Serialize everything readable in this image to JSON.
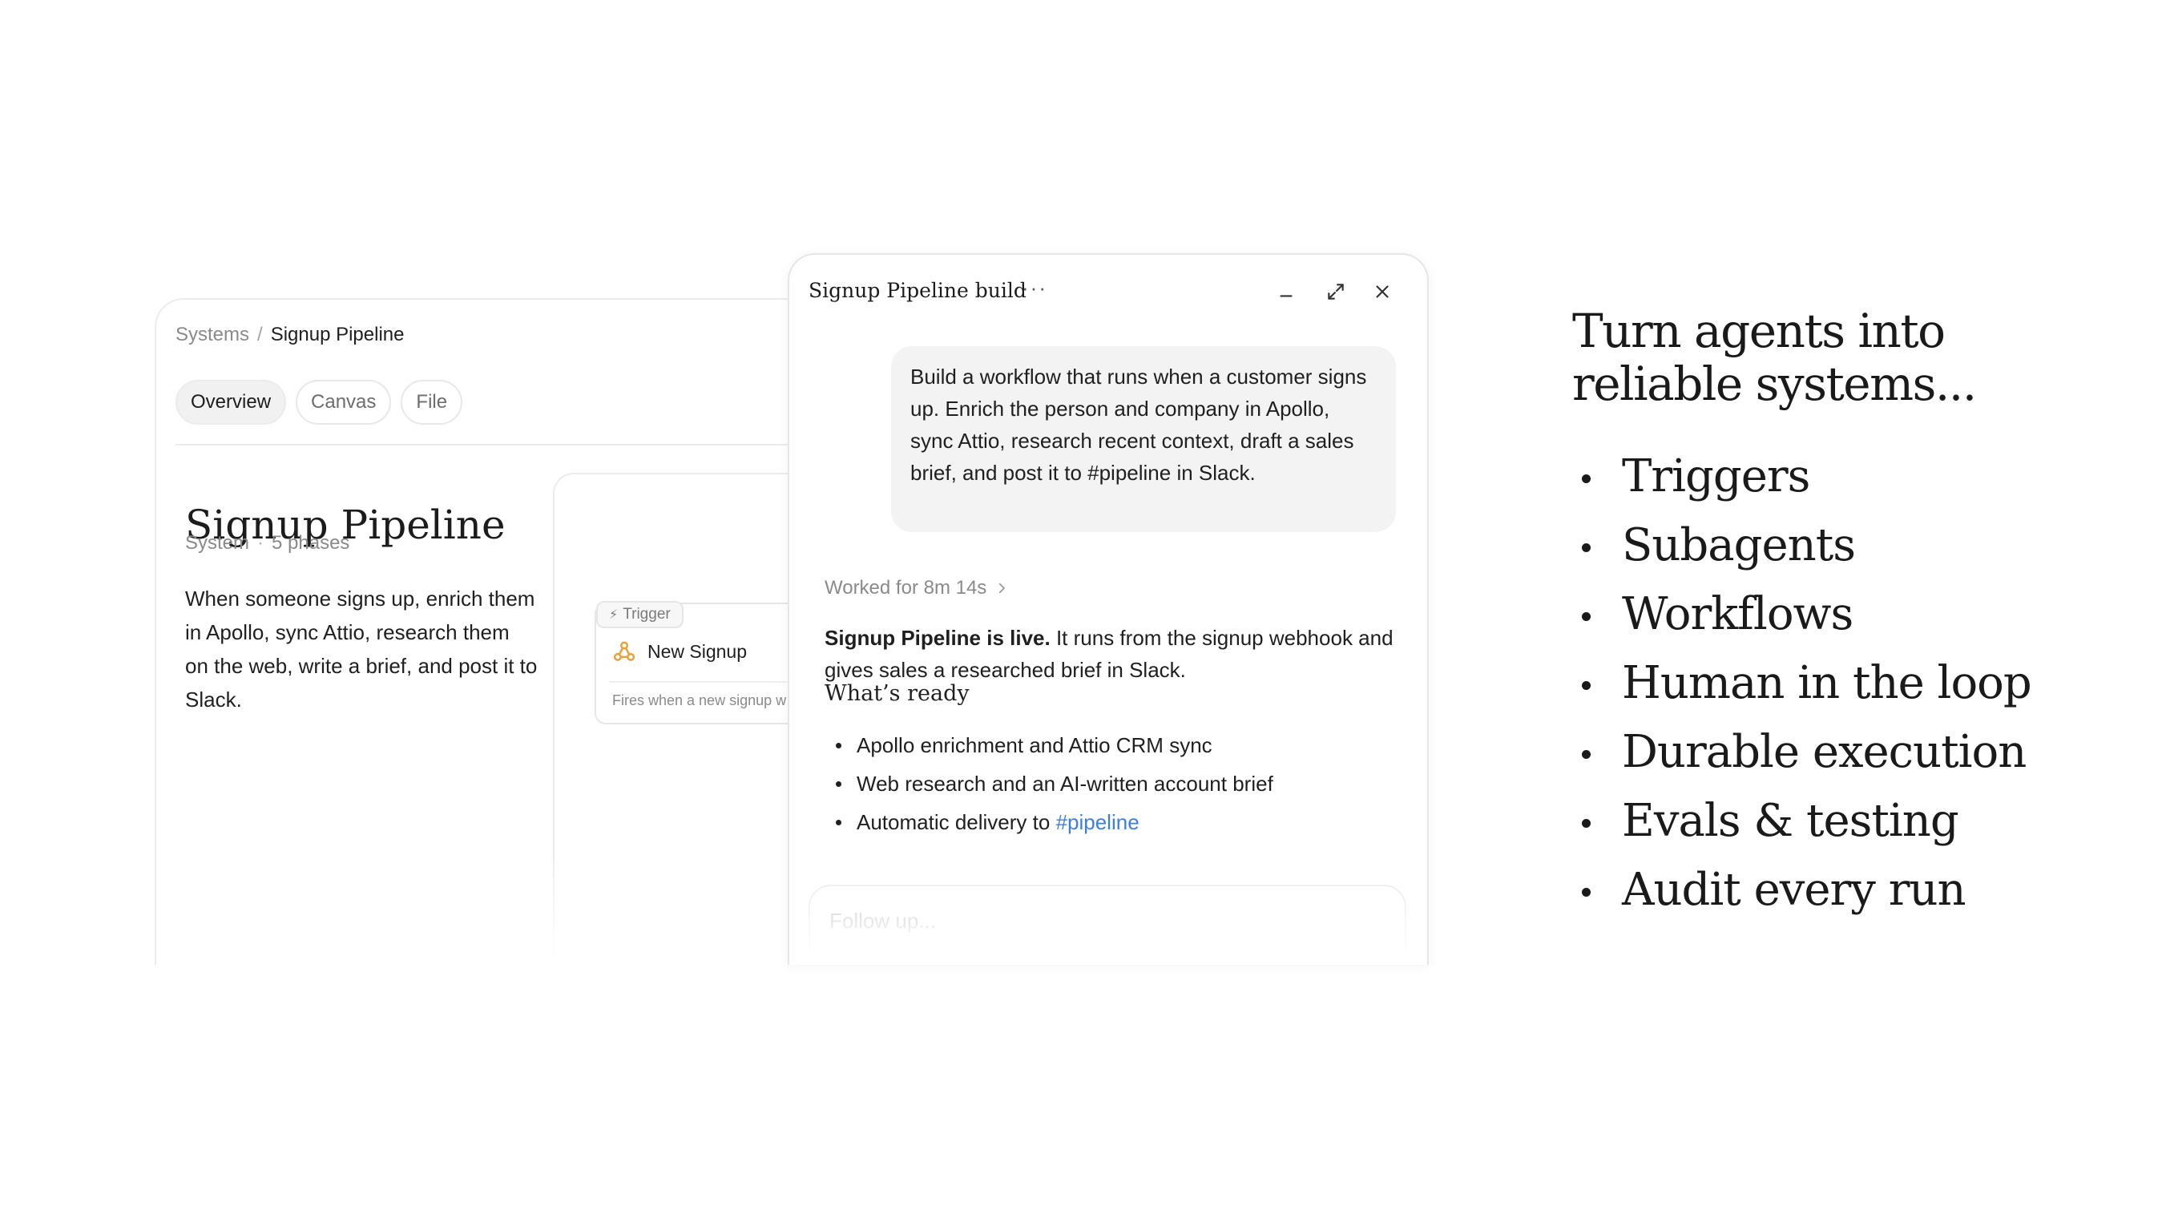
{
  "system_panel": {
    "breadcrumb": {
      "parent": "Systems",
      "separator": "/",
      "current": "Signup Pipeline"
    },
    "tabs": [
      {
        "label": "Overview",
        "active": true
      },
      {
        "label": "Canvas",
        "active": false
      },
      {
        "label": "File",
        "active": false
      }
    ],
    "title": "Signup Pipeline",
    "meta": {
      "kind": "System",
      "phases": "5 phases"
    },
    "description": "When someone signs up, enrich them in Apollo, sync Attio, research them on the web, write a brief, and post it to Slack.",
    "canvas": {
      "trigger_tag": "Trigger",
      "node_title": "New Signup",
      "node_caption": "Fires when a new signup w",
      "node_icon": "webhook-icon",
      "node_icon_color": "#e8a23a"
    }
  },
  "chat_panel": {
    "title": "Signup Pipeline build",
    "more_label": "···",
    "user_message": "Build a workflow that runs when a customer signs up. Enrich the person and company in Apollo, sync Attio, research recent context, draft a sales brief, and post it to #pipeline in Slack.",
    "worked_for": "Worked for 8m 14s",
    "response": {
      "lead_bold": "Signup Pipeline is live.",
      "lead_rest": " It runs from the signup webhook and gives sales a researched brief in Slack.",
      "heading": "What’s ready",
      "items": [
        {
          "text": "Apollo enrichment and Attio CRM sync"
        },
        {
          "text": "Web research and an AI-written account brief"
        },
        {
          "text": "Automatic delivery to ",
          "link": "#pipeline"
        }
      ]
    },
    "followup_placeholder": "Follow up...",
    "link_color": "#3a7ee6"
  },
  "hero": {
    "heading_line1": "Turn agents into",
    "heading_line2": "reliable systems...",
    "features": [
      "Triggers",
      "Subagents",
      "Workflows",
      "Human in the loop",
      "Durable execution",
      "Evals & testing",
      "Audit every run"
    ]
  }
}
